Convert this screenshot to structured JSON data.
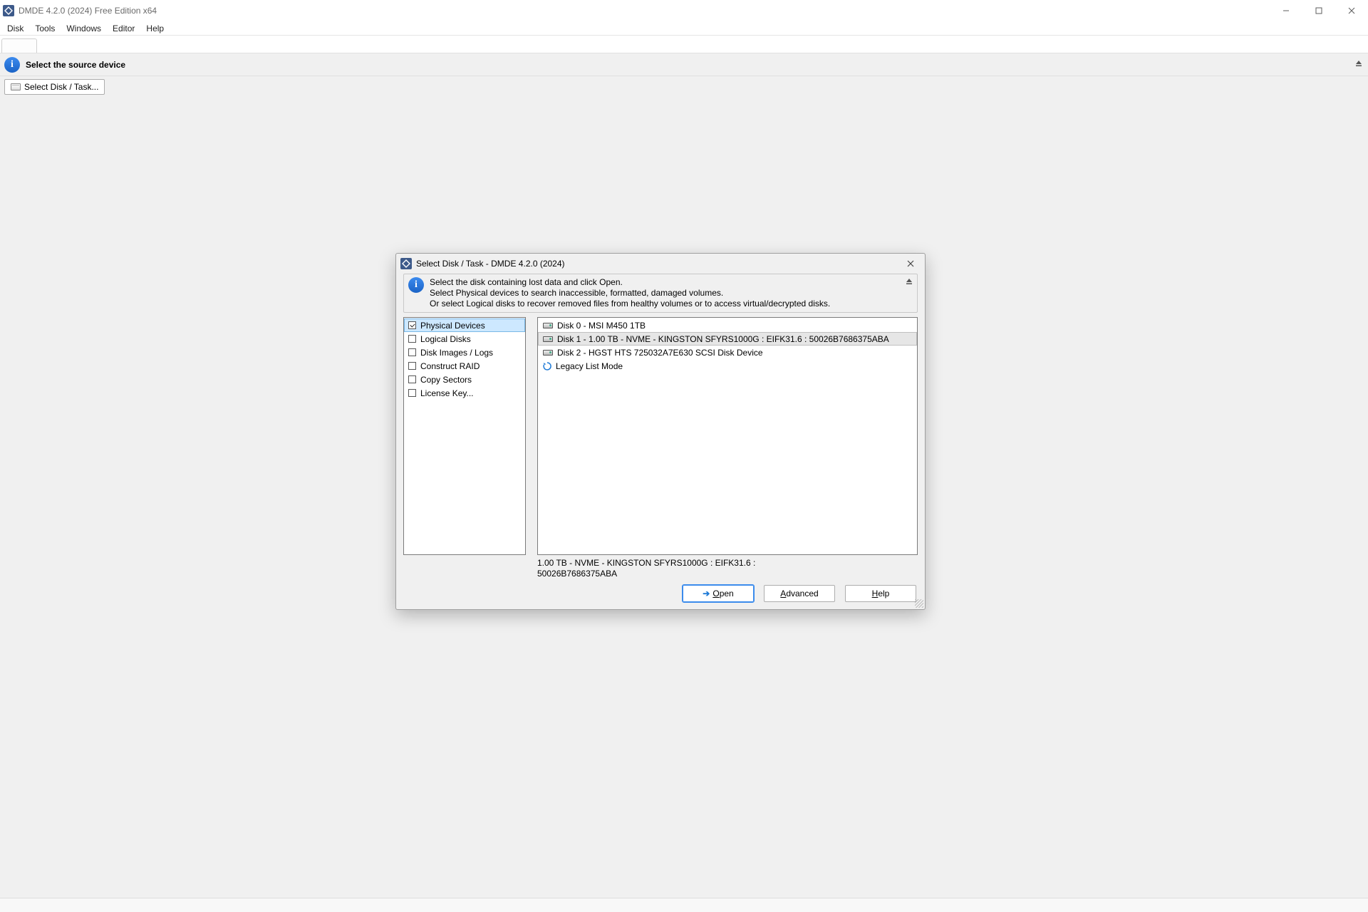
{
  "app": {
    "title": "DMDE 4.2.0 (2024) Free Edition x64",
    "menus": [
      "Disk",
      "Tools",
      "Windows",
      "Editor",
      "Help"
    ],
    "hint": "Select the source device",
    "toolbar_btn": "Select Disk / Task..."
  },
  "dialog": {
    "title": "Select Disk / Task - DMDE 4.2.0 (2024)",
    "info": {
      "line1": "Select the disk containing lost data and click Open.",
      "line2": "Select Physical devices to search inaccessible, formatted, damaged volumes.",
      "line3": "Or select Logical disks to recover removed files from healthy volumes or to access virtual/decrypted disks."
    },
    "tasks": [
      {
        "label": "Physical Devices",
        "checked": true,
        "selected": true
      },
      {
        "label": "Logical Disks",
        "checked": false,
        "selected": false
      },
      {
        "label": "Disk Images / Logs",
        "checked": false,
        "selected": false
      },
      {
        "label": "Construct RAID",
        "checked": false,
        "selected": false
      },
      {
        "label": "Copy Sectors",
        "checked": false,
        "selected": false
      },
      {
        "label": "License Key...",
        "checked": false,
        "selected": false
      }
    ],
    "devices": [
      {
        "kind": "hdd",
        "label": "Disk 0 - MSI M450 1TB",
        "selected": false
      },
      {
        "kind": "hdd",
        "label": "Disk 1 - 1.00 TB - NVME - KINGSTON SFYRS1000G : EIFK31.6 : 50026B7686375ABA",
        "selected": true
      },
      {
        "kind": "hdd",
        "label": "Disk 2 - HGST HTS 725032A7E630 SCSI Disk Device",
        "selected": false
      },
      {
        "kind": "refresh",
        "label": "Legacy List Mode",
        "selected": false
      }
    ],
    "selected_desc_l1": "1.00 TB - NVME - KINGSTON SFYRS1000G : EIFK31.6 :",
    "selected_desc_l2": "50026B7686375ABA",
    "buttons": {
      "open": "Open",
      "advanced": "Advanced",
      "help": "Help"
    }
  }
}
